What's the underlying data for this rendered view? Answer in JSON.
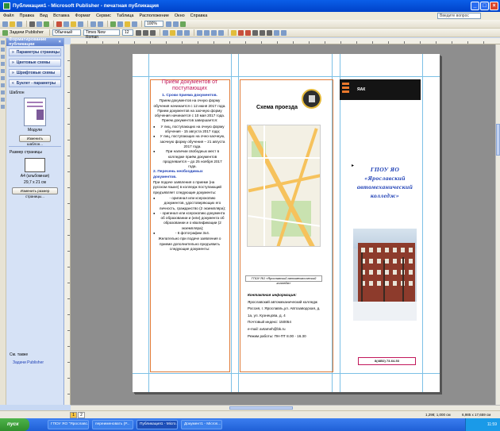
{
  "window": {
    "title": "Публикация1 - Microsoft Publisher - печатная публикация"
  },
  "menu": [
    "Файл",
    "Правка",
    "Вид",
    "Вставка",
    "Формат",
    "Сервис",
    "Таблица",
    "Расположение",
    "Окно",
    "Справка"
  ],
  "help_placeholder": "Введите вопрос",
  "toolbar": {
    "tasks": "Задачи Publisher",
    "style": "Обычный",
    "font": "Times New Roman",
    "size": "12",
    "zoom": "100%"
  },
  "taskpane": {
    "title": "Форматирование публикации",
    "sections": [
      "Параметры страницы",
      "Цветовые схемы",
      "Шрифтовые схемы",
      "Буклет - параметры"
    ],
    "template_label": "Шаблон",
    "template_name": "Модули",
    "change_template": "Изменить шаблон...",
    "page_size_label": "Размер страницы",
    "page_size_name": "A4 (альбомная)",
    "page_size_dims": "29,7 x 21 см",
    "change_page_size": "Изменить размер страницы...",
    "see_also": "См. также",
    "link": "Задачи Publisher"
  },
  "col1": {
    "title": "Приём документов от поступающих",
    "sec1": "1. Сроки приема документов.",
    "p1": "Прием документов на очную форму обучения начинается с 12 июня 2017 года.",
    "p2": "Прием документов на заочную форму обучения начинается с 10 мая 2017 года.",
    "p3": "Прием документов завершается:",
    "li1": "У лиц, поступающих на очную форму обучения - 15 августа 2017 года;",
    "li2": "У лиц, поступающих на очно-заочную, заочную форму обучения – 21 августа 2017 года.",
    "li3": "При наличии свободных мест в колледже приём документов продлевается – до 25 ноября 2017 года.",
    "sec2": "2. Перечень необходимых документов.",
    "p4": "При подаче заявления о приеме (на русском языке) в колледж поступающий предъявляет следующие документы:",
    "li4": "- оригинал или ксерокопию документов, удостоверяющих его личность, гражданство (2 экземпляра);",
    "li5": "- оригинал или ксерокопию документа об образовании и (или) документа об образовании и о квалификации (2 экземпляра);",
    "li6": "- 6 фотографии 3х4.",
    "p5": "Желательно при подаче заявления о приеме дополнительно предъявить следующие документы:"
  },
  "col2": {
    "scheme_title": "Схема проезда",
    "caption": "ГПОУ ЯО «Ярославский автомеханический колледж»",
    "contacts_head": "Контактная информация:",
    "c1": "Ярославский автомеханический колледж",
    "c2": "Россия, г. Ярославль,ул. Автозаводская, д. 1а, ул. Кузнецова, д. 4",
    "c3": "Почтовый индекс: 150054",
    "c4": "e-mail: avtameh@bk.ru",
    "c5": "Режим работы: ПН-ПТ 8.00 - 16.30"
  },
  "col3": {
    "bar_label": "ЯАК",
    "org": "ГПОУ ЯО «Ярославский автомеханический колледж»",
    "phone": "8(4852) 73-64-53"
  },
  "status": {
    "pages": [
      "1",
      "2"
    ],
    "pos": "1,298; 1,000 см",
    "size": "6,985 x 17,659 см"
  },
  "taskbar": {
    "start": "пуск",
    "tasks": [
      "ГПОУ ЯО \"Ярославс...",
      "переименовать (Р...",
      "Публикация1 - Micro...",
      "Документ1 - Micros..."
    ],
    "clock": "11:59"
  },
  "colors": {
    "accent_orange": "#e9782c",
    "title_magenta": "#c2185b",
    "link_blue": "#1d3fb5"
  }
}
